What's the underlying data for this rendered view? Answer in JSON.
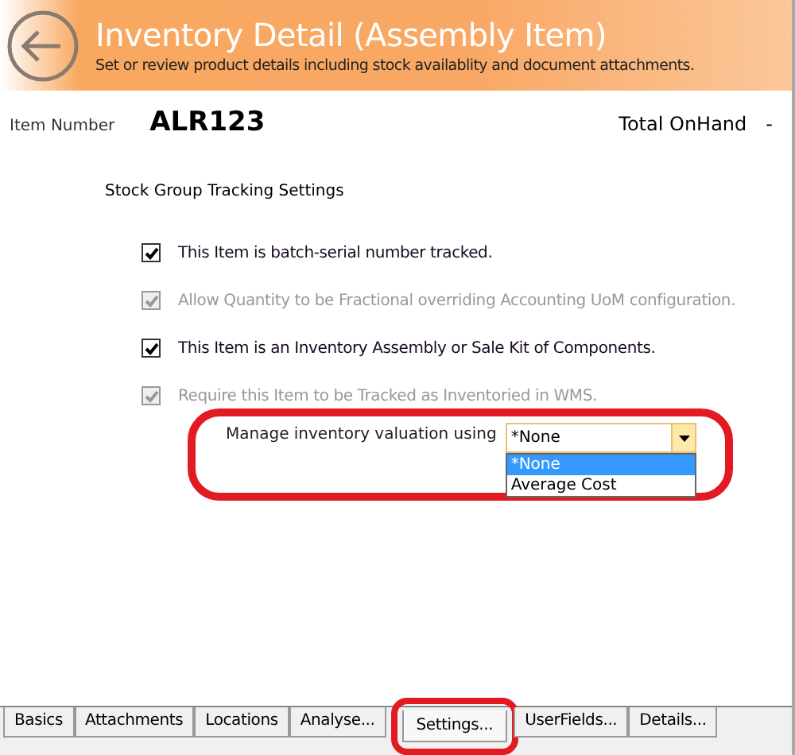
{
  "header": {
    "title": "Inventory Detail (Assembly Item)",
    "subtitle": "Set or review product details including stock availablity and document attachments."
  },
  "item": {
    "label": "Item Number",
    "value": "ALR123",
    "total_label": "Total OnHand",
    "total_value": "-"
  },
  "section_title": "Stock Group Tracking Settings",
  "options": [
    {
      "label": "This Item is batch-serial number tracked.",
      "checked": true,
      "disabled": false
    },
    {
      "label": "Allow Quantity to be Fractional overriding Accounting UoM configuration.",
      "checked": true,
      "disabled": true
    },
    {
      "label": "This Item is an Inventory Assembly or Sale Kit of Components.",
      "checked": true,
      "disabled": false
    },
    {
      "label": "Require this Item to be Tracked as Inventoried in WMS.",
      "checked": true,
      "disabled": true
    }
  ],
  "valuation": {
    "label": "Manage inventory valuation using",
    "value": "*None",
    "expanded": true,
    "options": [
      {
        "label": "*None",
        "selected": true
      },
      {
        "label": "Average Cost",
        "selected": false
      }
    ]
  },
  "tabs": [
    {
      "label": "Basics",
      "selected": false
    },
    {
      "label": "Attachments",
      "selected": false
    },
    {
      "label": "Locations",
      "selected": false
    },
    {
      "label": "Analyse...",
      "selected": false
    },
    {
      "label": "Settings...",
      "selected": true
    },
    {
      "label": "UserFields...",
      "selected": false
    },
    {
      "label": "Details...",
      "selected": false
    }
  ]
}
